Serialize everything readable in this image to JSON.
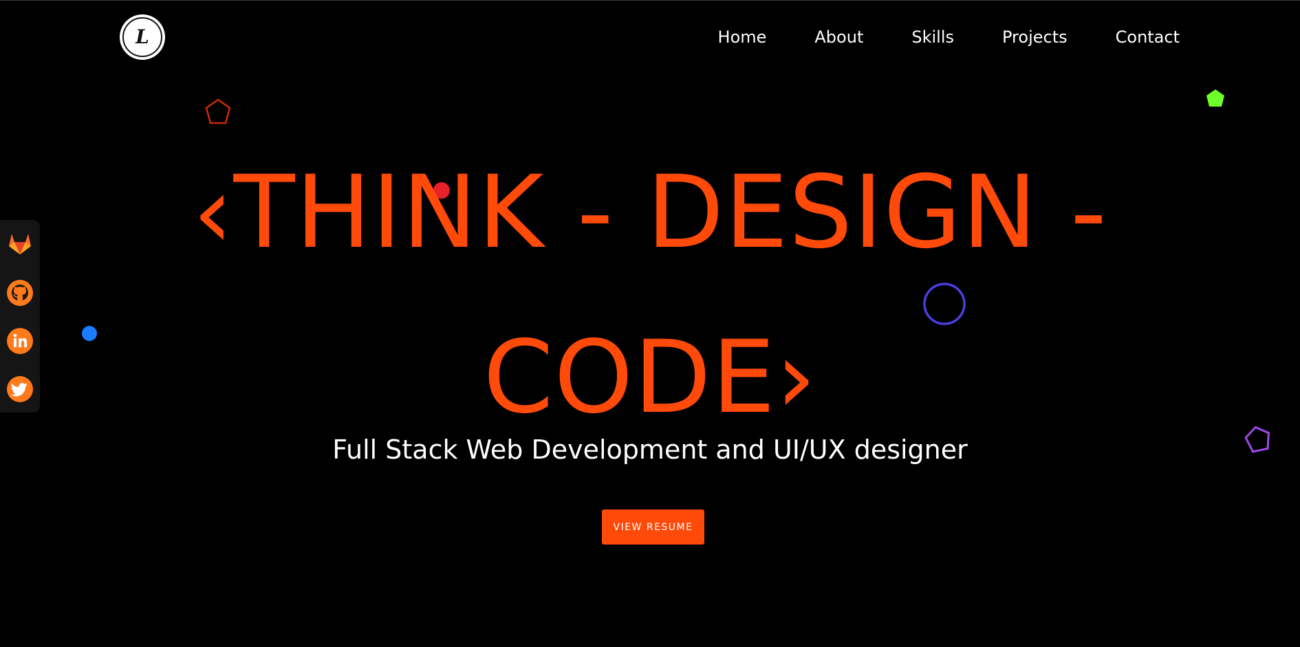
{
  "colors": {
    "accent": "#ff4a0a",
    "background": "#000000",
    "text": "#ffffff",
    "sidebar_bg": "#151515"
  },
  "logo": {
    "letter": "L",
    "icon": "logo-icon"
  },
  "nav": {
    "items": [
      {
        "label": "Home"
      },
      {
        "label": "About"
      },
      {
        "label": "Skills"
      },
      {
        "label": "Projects"
      },
      {
        "label": "Contact"
      }
    ]
  },
  "social": {
    "items": [
      {
        "icon": "gitlab-icon"
      },
      {
        "icon": "github-icon"
      },
      {
        "icon": "linkedin-icon"
      },
      {
        "icon": "twitter-icon"
      }
    ]
  },
  "hero": {
    "line1": "‹THINK - DESIGN -",
    "line2": "CODE›",
    "subtitle": "Full Stack Web Development and UI/UX designer",
    "button_label": "VIEW RESUME"
  },
  "decorations": [
    {
      "icon": "pentagon-outline-icon",
      "color": "#cc2a0a"
    },
    {
      "icon": "pentagon-filled-icon",
      "color": "#6eff2a"
    },
    {
      "icon": "dot-icon",
      "color": "#e8202a"
    },
    {
      "icon": "circle-outline-icon",
      "color": "#4b3fe0"
    },
    {
      "icon": "dot-icon",
      "color": "#1a7dff"
    },
    {
      "icon": "pentagon-outline-icon",
      "color": "#a04be8"
    }
  ]
}
